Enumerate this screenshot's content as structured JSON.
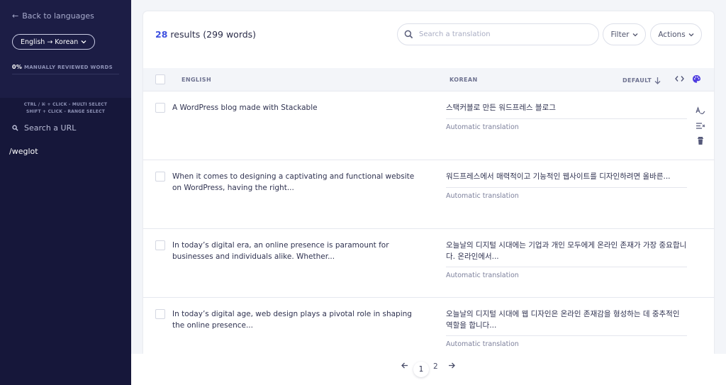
{
  "sidebar": {
    "back_label": "Back to languages",
    "language_pair": "English → Korean",
    "reviewed_percent": "0%",
    "reviewed_label": "MANUALLY REVIEWED WORDS",
    "hint_multi": "CTRL / ⌘ + CLICK - MULTI SELECT",
    "hint_range": "SHIFT + CLICK - RANGE SELECT",
    "search_url_label": "Search a URL",
    "path": "/weglot"
  },
  "toolbar": {
    "results_count": "28",
    "results_rest": "results (299 words)",
    "search_placeholder": "Search a translation",
    "filter_label": "Filter",
    "actions_label": "Actions"
  },
  "table": {
    "col_source": "ENGLISH",
    "col_target": "KOREAN",
    "col_sort": "DEFAULT",
    "rows": [
      {
        "source": "A WordPress blog made with Stackable",
        "target": "스택커블로 만든 워드프레스 블로그",
        "status": "Automatic translation"
      },
      {
        "source": "When it comes to designing a captivating and functional website on WordPress, having the right...",
        "target": "워드프레스에서 매력적이고 기능적인 웹사이트를 디자인하려면 올바른...",
        "status": "Automatic translation"
      },
      {
        "source": "In today’s digital era, an online presence is paramount for businesses and individuals alike. Whether...",
        "target": "오늘날의 디지털 시대에는 기업과 개인 모두에게 온라인 존재가 가장 중요합니다. 온라인에서...",
        "status": "Automatic translation"
      },
      {
        "source": "In today’s digital age, web design plays a pivotal role in shaping the online presence...",
        "target": "오늘날의 디지털 시대에 웹 디자인은 온라인 존재감을 형성하는 데 중추적인 역할을 합니다...",
        "status": "Automatic translation"
      }
    ]
  },
  "pagination": {
    "pages": [
      "1",
      "2"
    ],
    "current": "1"
  },
  "colors": {
    "sidebar_bg": "#16173a",
    "accent": "#3d50e0",
    "palette_icon": "#4f3de0"
  }
}
